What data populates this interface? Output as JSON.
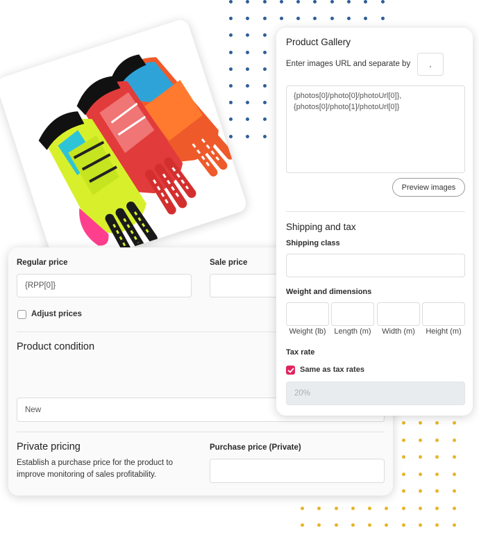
{
  "form": {
    "regular_price_label": "Regular price",
    "regular_price_value": "{RPP[0]}",
    "sale_price_label": "Sale price",
    "adjust_prices_label": "Adjust prices",
    "product_condition_heading": "Product condition",
    "condition_value": "New",
    "private_pricing_heading": "Private pricing",
    "private_pricing_description_line1": "Establish a purchase price for the product to",
    "private_pricing_description_line2": "improve monitoring of sales profitability.",
    "purchase_price_label": "Purchase price (Private)"
  },
  "gallery": {
    "heading": "Product Gallery",
    "instruction": "Enter images URL and separate by",
    "separator_value": ",",
    "urls_line1": "{photos[0]/photo[0]/photoUrl[0]},",
    "urls_line2": "{photos[0]/photo[1]/photoUrl[0]}",
    "preview_button": "Preview images"
  },
  "shipping": {
    "heading": "Shipping and tax",
    "shipping_class_label": "Shipping class",
    "weight_dimensions_label": "Weight and dimensions",
    "dimension_labels": [
      "Weight (lb)",
      "Length (m)",
      "Width (m)",
      "Height (m)"
    ],
    "tax_rate_label": "Tax rate",
    "same_as_tax_label": "Same as tax rates",
    "tax_rate_value": "20%"
  },
  "colors": {
    "accent_checkbox": "#e0245e",
    "dots_blue": "#2f5f98",
    "dots_yellow": "#e6b52a"
  },
  "image": {
    "product_photo": "motocross-gloves-photo"
  }
}
